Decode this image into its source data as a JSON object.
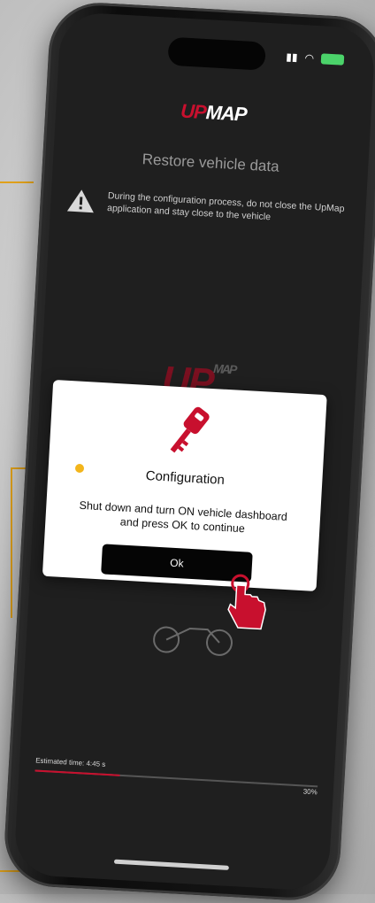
{
  "app": {
    "logo_up": "UP",
    "logo_map": "MAP",
    "bg_logo_up": "UP",
    "bg_logo_map": "MAP"
  },
  "screen": {
    "title": "Restore vehicle data",
    "warning_text": "During the configuration process, do not close the UpMap application and stay close to the vehicle"
  },
  "dialog": {
    "title": "Configuration",
    "message_line1": "Shut down and turn ON vehicle dashboard",
    "message_line2": "and press OK to continue",
    "ok_label": "Ok"
  },
  "progress": {
    "label": "Estimated time: 4:45 s",
    "percent_label": "30%",
    "fraction": 0.3
  },
  "colors": {
    "accent": "#c8102e",
    "callout": "#e0a11b"
  },
  "icons": [
    "warning-icon",
    "key-icon",
    "signal-icon",
    "wifi-icon",
    "battery-icon",
    "pointing-hand-icon"
  ]
}
